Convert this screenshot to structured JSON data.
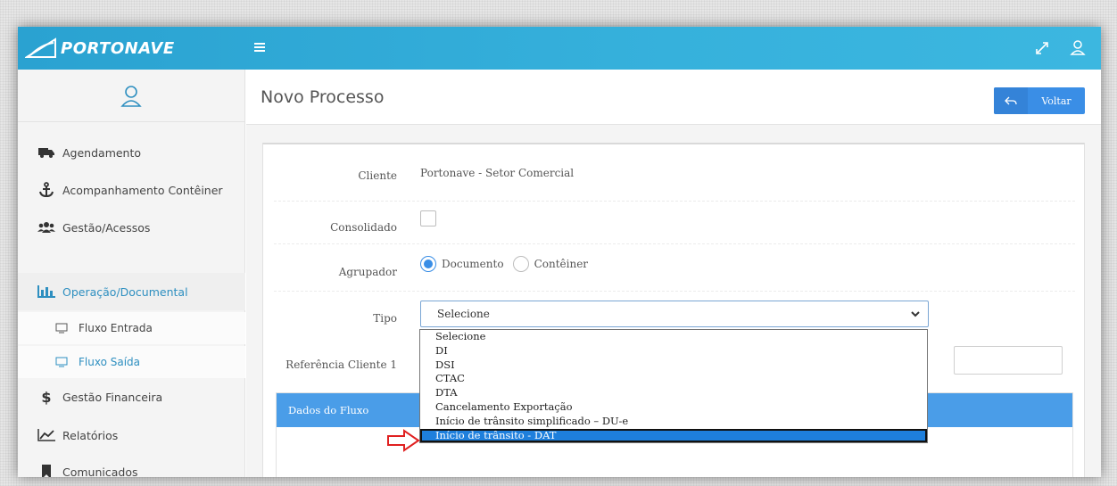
{
  "app": {
    "brand": "PORTONAVE"
  },
  "topbar": {
    "menu_icon": "hamburger-menu-icon",
    "icons": [
      "fullscreen-icon",
      "user-icon"
    ]
  },
  "sidebar": {
    "avatar_icon": "user-icon",
    "items": [
      {
        "label": "Agendamento",
        "icon": "truck-icon"
      },
      {
        "label": "Acompanhamento Contêiner",
        "icon": "anchor-icon"
      },
      {
        "label": "Gestão/Acessos",
        "icon": "users-icon"
      },
      {
        "label": "Operação/Documental",
        "icon": "bar-chart-icon",
        "active": true
      },
      {
        "label": "Fluxo Entrada",
        "icon": "monitor-icon"
      },
      {
        "label": "Fluxo Saída",
        "icon": "monitor-icon",
        "active": true
      },
      {
        "label": "Gestão Financeira",
        "icon": "dollar-icon"
      },
      {
        "label": "Relatórios",
        "icon": "line-chart-icon"
      },
      {
        "label": "Comunicados",
        "icon": "bookmark-icon"
      }
    ]
  },
  "page": {
    "title": "Novo Processo",
    "back_button": {
      "label": "Voltar",
      "icon": "reply-icon"
    }
  },
  "form": {
    "cliente": {
      "label": "Cliente",
      "value": "Portonave - Setor Comercial"
    },
    "consolidado": {
      "label": "Consolidado",
      "checked": false
    },
    "agrupador": {
      "label": "Agrupador",
      "options": [
        {
          "label": "Documento",
          "checked": true
        },
        {
          "label": "Contêiner",
          "checked": false
        }
      ]
    },
    "tipo": {
      "label": "Tipo",
      "selected": "Selecione",
      "options": [
        "Selecione",
        "DI",
        "DSI",
        "CTAC",
        "DTA",
        "Cancelamento Exportação",
        "Início de trânsito simplificado – DU-e",
        "Início de trânsito - DAT"
      ],
      "highlighted_index": 7
    },
    "referencia": {
      "label": "Referência Cliente 1",
      "value": ""
    }
  },
  "panel": {
    "title": "Dados do Fluxo"
  },
  "colors": {
    "topbar": "#36b1dc",
    "accent": "#3a8ee6",
    "panel_header": "#4a9de8",
    "active_nav": "#2e8fc0",
    "annotation_arrow": "#e02020"
  }
}
